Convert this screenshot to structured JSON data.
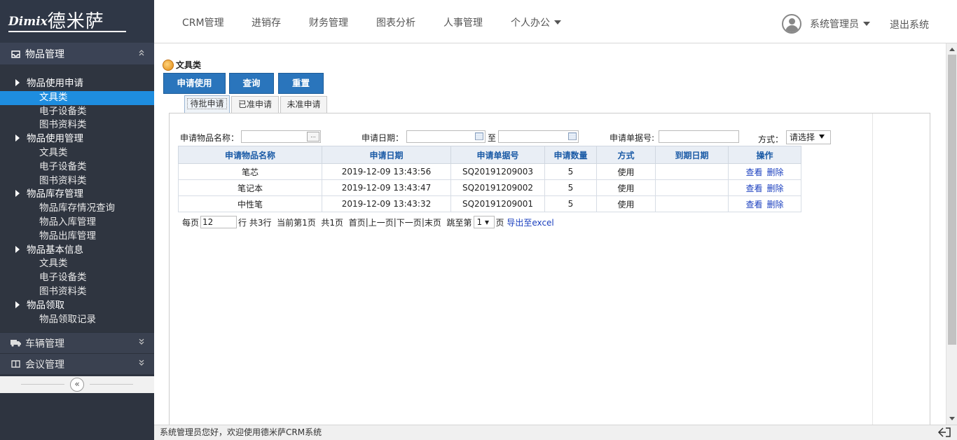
{
  "brand": {
    "logo_latin": "Dimix",
    "logo_cjk": "德米萨"
  },
  "topnav": {
    "items": [
      "CRM管理",
      "进销存",
      "财务管理",
      "图表分析",
      "人事管理",
      "个人办公"
    ],
    "user": "系统管理员",
    "logout": "退出系统"
  },
  "sidebar": {
    "active_menu": "物品管理",
    "tree": [
      {
        "group": "物品使用申请",
        "items": [
          "文具类",
          "电子设备类",
          "图书资料类"
        ]
      },
      {
        "group": "物品使用管理",
        "items": [
          "文具类",
          "电子设备类",
          "图书资料类"
        ]
      },
      {
        "group": "物品库存管理",
        "items": [
          "物品库存情况查询",
          "物品入库管理",
          "物品出库管理"
        ]
      },
      {
        "group": "物品基本信息",
        "items": [
          "文具类",
          "电子设备类",
          "图书资料类"
        ]
      },
      {
        "group": "物品领取",
        "items": [
          "物品领取记录"
        ]
      }
    ],
    "selected_item": "文具类",
    "other_menus": [
      "车辆管理",
      "会议管理"
    ],
    "collapse_glyph": "«"
  },
  "page": {
    "title": "文具类",
    "buttons": [
      "申请使用",
      "查询",
      "重置"
    ],
    "tabs": [
      "待批申请",
      "已准申请",
      "未准申请"
    ],
    "active_tab": "待批申请"
  },
  "filters": {
    "item_name_label": "申请物品名称：",
    "item_name_value": "",
    "item_name_button": "...",
    "date_label": "申请日期：",
    "date_to": "至",
    "doc_no_label": "申请单据号:",
    "method_label": "方式：",
    "method_value": "请选择"
  },
  "table": {
    "headers": [
      "申请物品名称",
      "申请日期",
      "申请单据号",
      "申请数量",
      "方式",
      "到期日期",
      "操作"
    ],
    "rows": [
      {
        "name": "笔芯",
        "date": "2019-12-09 13:43:56",
        "doc": "SQ20191209003",
        "qty": "5",
        "method": "使用",
        "due": "",
        "view": "查看",
        "del": "删除"
      },
      {
        "name": "笔记本",
        "date": "2019-12-09 13:43:47",
        "doc": "SQ20191209002",
        "qty": "5",
        "method": "使用",
        "due": "",
        "view": "查看",
        "del": "删除"
      },
      {
        "name": "中性笔",
        "date": "2019-12-09 13:43:32",
        "doc": "SQ20191209001",
        "qty": "5",
        "method": "使用",
        "due": "",
        "view": "查看",
        "del": "删除"
      }
    ]
  },
  "pager": {
    "per_page_label": "每页",
    "per_page_value": "12",
    "rows_text": "行 共3行",
    "current_text": "当前第1页",
    "total_text": "共1页",
    "first": "首页",
    "prev": "上一页",
    "next": "下一页",
    "last": "末页",
    "jump_label": "跳至第",
    "jump_value": "1",
    "page_suffix": "页",
    "export": "导出至excel",
    "sep": "|"
  },
  "status": {
    "welcome": "系统管理员您好，欢迎使用德米萨CRM系统"
  }
}
